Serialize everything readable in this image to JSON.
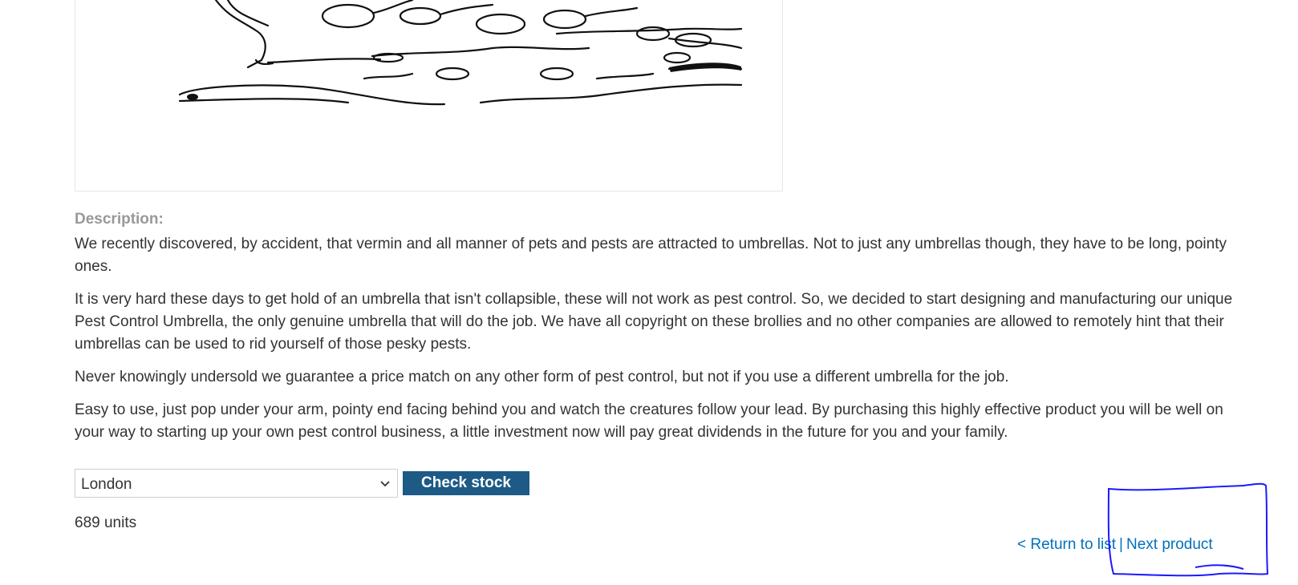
{
  "product": {
    "description_label": "Description:",
    "paragraphs": [
      "We recently discovered, by accident, that vermin and all manner of pets and pests are attracted to umbrellas. Not to just any umbrellas though, they have to be long, pointy ones.",
      "It is very hard these days to get hold of an umbrella that isn't collapsible, these will not work as pest control. So, we decided to start designing and manufacturing our unique Pest Control Umbrella, the only genuine umbrella that will do the job. We have all copyright on these brollies and no other companies are allowed to remotely hint that their umbrellas can be used to rid yourself of those pesky pests.",
      "Never knowingly undersold we guarantee a price match on any other form of pest control, but not if you use a different umbrella for the job.",
      "Easy to use, just pop under your arm, pointy end facing behind you and watch the creatures follow your lead. By purchasing this highly effective product you will be well on your way to starting up your own pest control business, a little investment now will pay great dividends in the future for you and your family."
    ]
  },
  "stock": {
    "selected_city": "London",
    "button_label": "Check stock",
    "result": "689 units"
  },
  "nav": {
    "return_label": "< Return to list",
    "separator": "|",
    "next_label": "Next product"
  },
  "colors": {
    "button_bg": "#1d5a86",
    "link": "#0071bc",
    "label_gray": "#999999",
    "annotation": "#1a1aff"
  },
  "icons": {
    "select_arrow": "chevron-down-icon"
  }
}
